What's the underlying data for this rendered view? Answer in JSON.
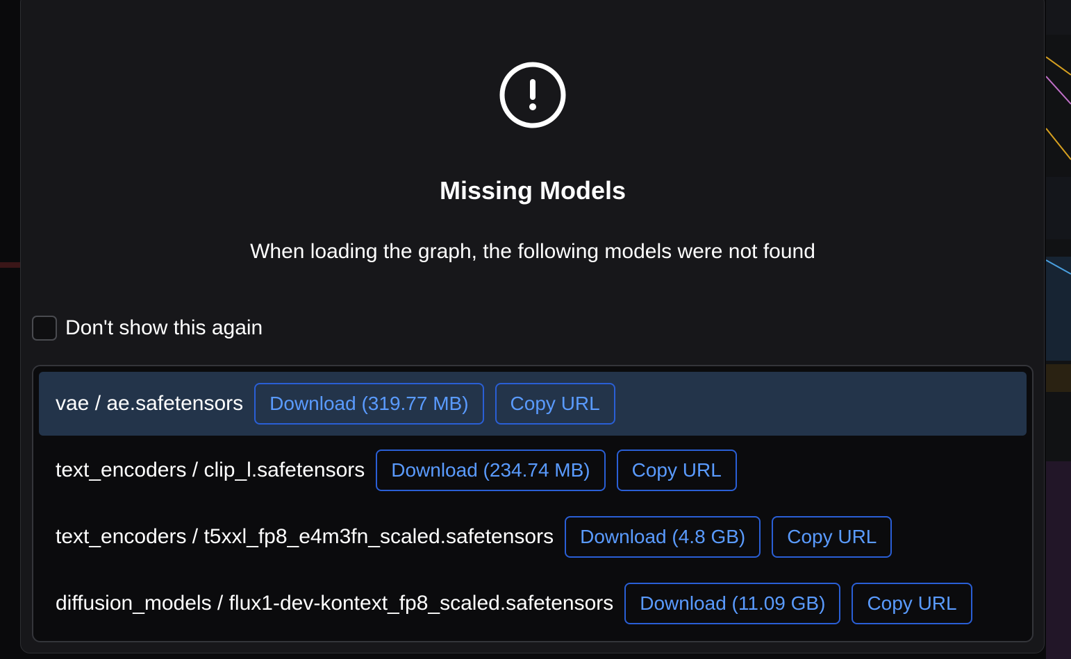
{
  "dialog": {
    "icon": "exclamation-circle-icon",
    "title": "Missing Models",
    "subtitle": "When loading the graph, the following models were not found",
    "dont_show_again": {
      "label": "Don't show this again",
      "checked": false
    },
    "models": [
      {
        "name": "vae / ae.safetensors",
        "download_label": "Download (319.77 MB)",
        "copy_label": "Copy URL",
        "selected": true
      },
      {
        "name": "text_encoders / clip_l.safetensors",
        "download_label": "Download (234.74 MB)",
        "copy_label": "Copy URL",
        "selected": false
      },
      {
        "name": "text_encoders / t5xxl_fp8_e4m3fn_scaled.safetensors",
        "download_label": "Download (4.8 GB)",
        "copy_label": "Copy URL",
        "selected": false
      },
      {
        "name": "diffusion_models / flux1-dev-kontext_fp8_scaled.safetensors",
        "download_label": "Download (11.09 GB)",
        "copy_label": "Copy URL",
        "selected": false
      }
    ]
  },
  "colors": {
    "dialog_bg": "#17171a",
    "list_bg": "#0b0b0d",
    "selected_row_bg": "#23344a",
    "button_border": "#2a5fd6",
    "button_text": "#5a9bff",
    "text": "#ffffff"
  }
}
